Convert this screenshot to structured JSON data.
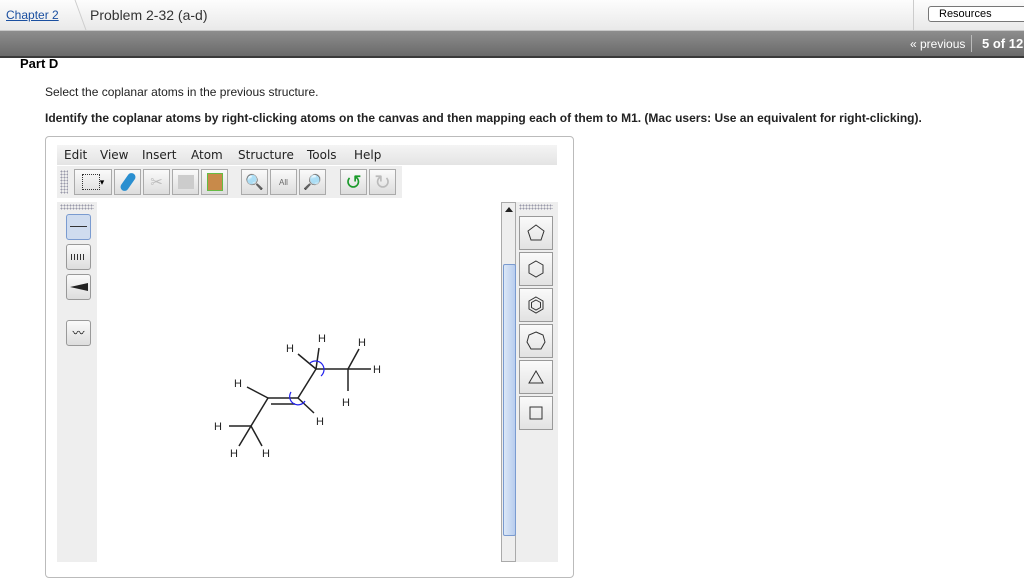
{
  "header": {
    "breadcrumb_chapter": "Chapter 2",
    "problem_title": "Problem 2-32 (a-d)",
    "resources_label": "Resources"
  },
  "nav": {
    "previous_label": "« previous",
    "position": "5 of 12"
  },
  "part": {
    "title": "Part D",
    "prompt": "Select the coplanar atoms in the previous structure.",
    "instruction": "Identify the coplanar atoms by right-clicking atoms on the canvas and then mapping each of them to M1. (Mac users: Use an equivalent for right-clicking)."
  },
  "editor": {
    "menu": [
      "Edit",
      "View",
      "Insert",
      "Atom",
      "Structure",
      "Tools",
      "Help"
    ],
    "toolbar": [
      "select-icon",
      "eraser-icon",
      "cut-icon",
      "copy-icon",
      "paste-icon",
      "zoom-in-icon",
      "zoom-all-icon",
      "zoom-out-icon",
      "undo-icon",
      "redo-icon"
    ],
    "zoom_all_label": "All",
    "bond_tools": [
      "single-bond",
      "hashed-bond",
      "wedge-bond",
      "wavy-bond"
    ],
    "templates": [
      "cyclopentane",
      "cyclohexane",
      "benzene",
      "cycloheptane",
      "cyclopropane",
      "cyclobutane"
    ],
    "atom_label": "H",
    "mapping_color": "#2222ee"
  }
}
